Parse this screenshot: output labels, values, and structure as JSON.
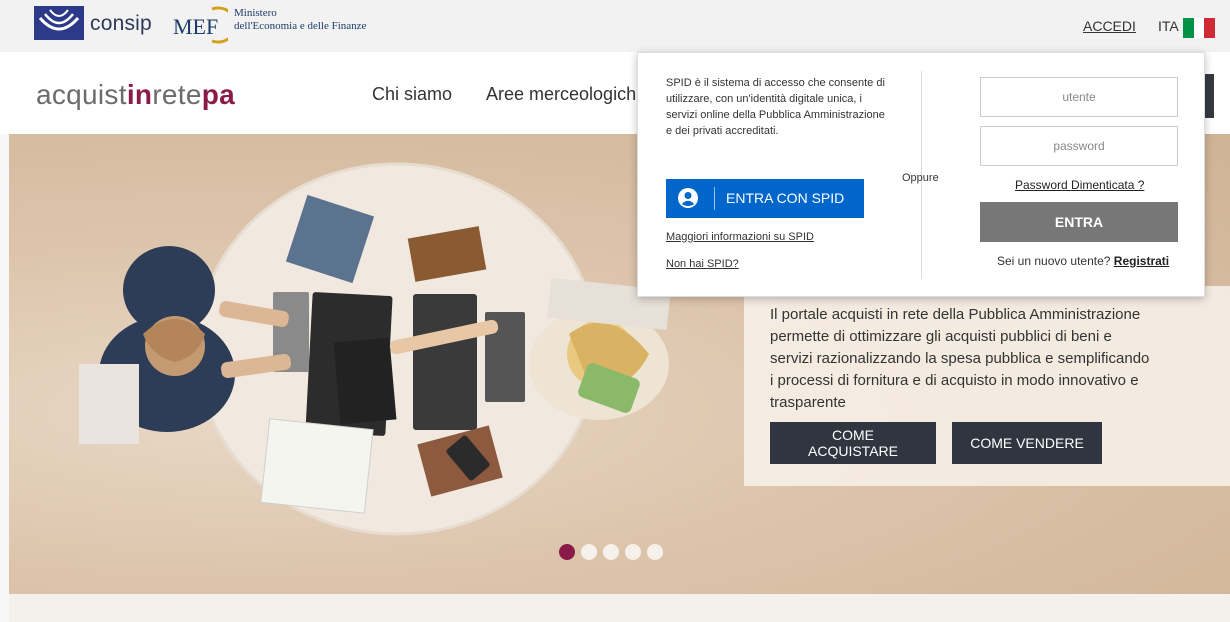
{
  "topbar": {
    "consip_text": "consip",
    "mef_logo_text": "MEF",
    "mef_text_line1": "Ministero",
    "mef_text_line2": "dell'Economia e delle Finanze",
    "accedi_label": "ACCEDI",
    "language": "ITA",
    "flag_colors": [
      "#009246",
      "#ffffff",
      "#ce2b37"
    ]
  },
  "navbar": {
    "brand_part1": "acquist",
    "brand_part2": "in",
    "brand_part3": "rete",
    "brand_part4": "pa",
    "items": [
      {
        "label": "Chi siamo"
      },
      {
        "label": "Aree merceologich"
      }
    ]
  },
  "hero": {
    "description": "Il portale acquisti in rete della Pubblica Amministrazione permette di ottimizzare gli acquisti pubblici di beni e servizi razionalizzando la spesa pubblica e semplificando i processi di fornitura e di acquisto in modo innovativo e trasparente",
    "buy_button": "COME ACQUISTARE",
    "sell_button": "COME VENDERE",
    "slide_count": 5,
    "active_slide": 1
  },
  "login": {
    "spid_description": "SPID è il sistema di accesso che consente di utilizzare, con un'identità digitale unica, i servizi online della Pubblica Amministrazione e dei privati accreditati.",
    "spid_button": "ENTRA CON SPID",
    "spid_more_info": "Maggiori informazioni su SPID",
    "no_spid": "Non hai SPID?",
    "or_label": "Oppure",
    "username_placeholder": "utente",
    "password_placeholder": "password",
    "forgot_password": "Password Dimenticata ?",
    "submit_button": "ENTRA",
    "new_user_text": "Sei un nuovo utente?",
    "register_link": "Registrati"
  },
  "colors": {
    "brand_red": "#8a1a47",
    "spid_blue": "#0066cc",
    "dark_button": "#2f3640",
    "entra_gray": "#777777"
  }
}
